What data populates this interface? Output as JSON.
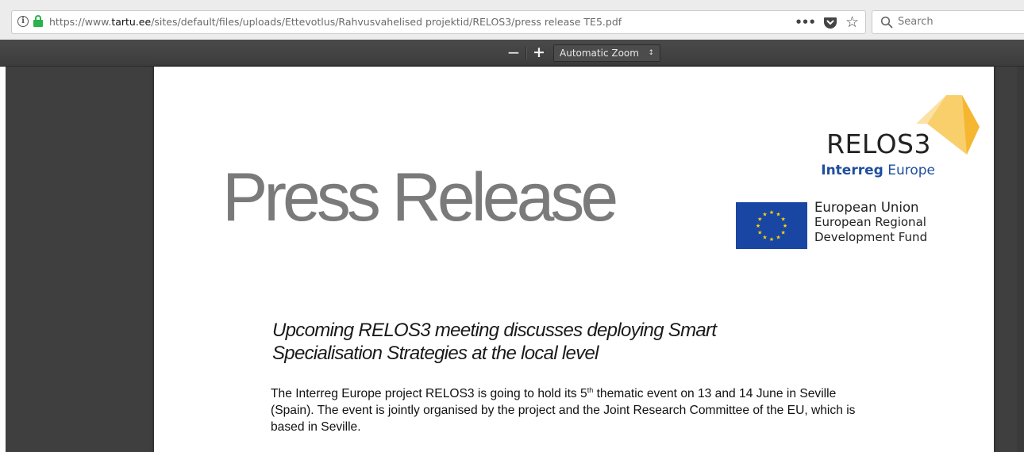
{
  "browser": {
    "url_prefix": "https://www.",
    "url_domain": "tartu.ee",
    "url_path": "/sites/default/files/uploads/Ettevotlus/Rahvusvahelised projektid/RELOS3/press release TE5.pdf",
    "page_actions_label": "•••",
    "search_placeholder": "Search"
  },
  "pdf_toolbar": {
    "zoom_out_label": "−",
    "zoom_in_label": "+",
    "zoom_select_value": "Automatic Zoom"
  },
  "document": {
    "press_title": "Press Release",
    "logo": {
      "name": "RELOS3",
      "interreg_bold": "Interreg",
      "interreg_rest": " Europe",
      "brand_color": "#f5b731",
      "interreg_color": "#1f4e9e"
    },
    "eu": {
      "line1": "European Union",
      "line2": "European Regional",
      "line3": "Development Fund",
      "flag_color": "#1a46a3",
      "star_color": "#ffd800"
    },
    "headline": "Upcoming RELOS3 meeting discusses deploying Smart Specialisation Strategies at the local level",
    "body_part1": "The Interreg Europe project RELOS3 is going to hold its 5",
    "body_sup": "th",
    "body_part2": " thematic event on 13 and 14 June in Seville (Spain).  The event is jointly organised by the project and the Joint Research Committee of the EU, which is based in Seville."
  }
}
